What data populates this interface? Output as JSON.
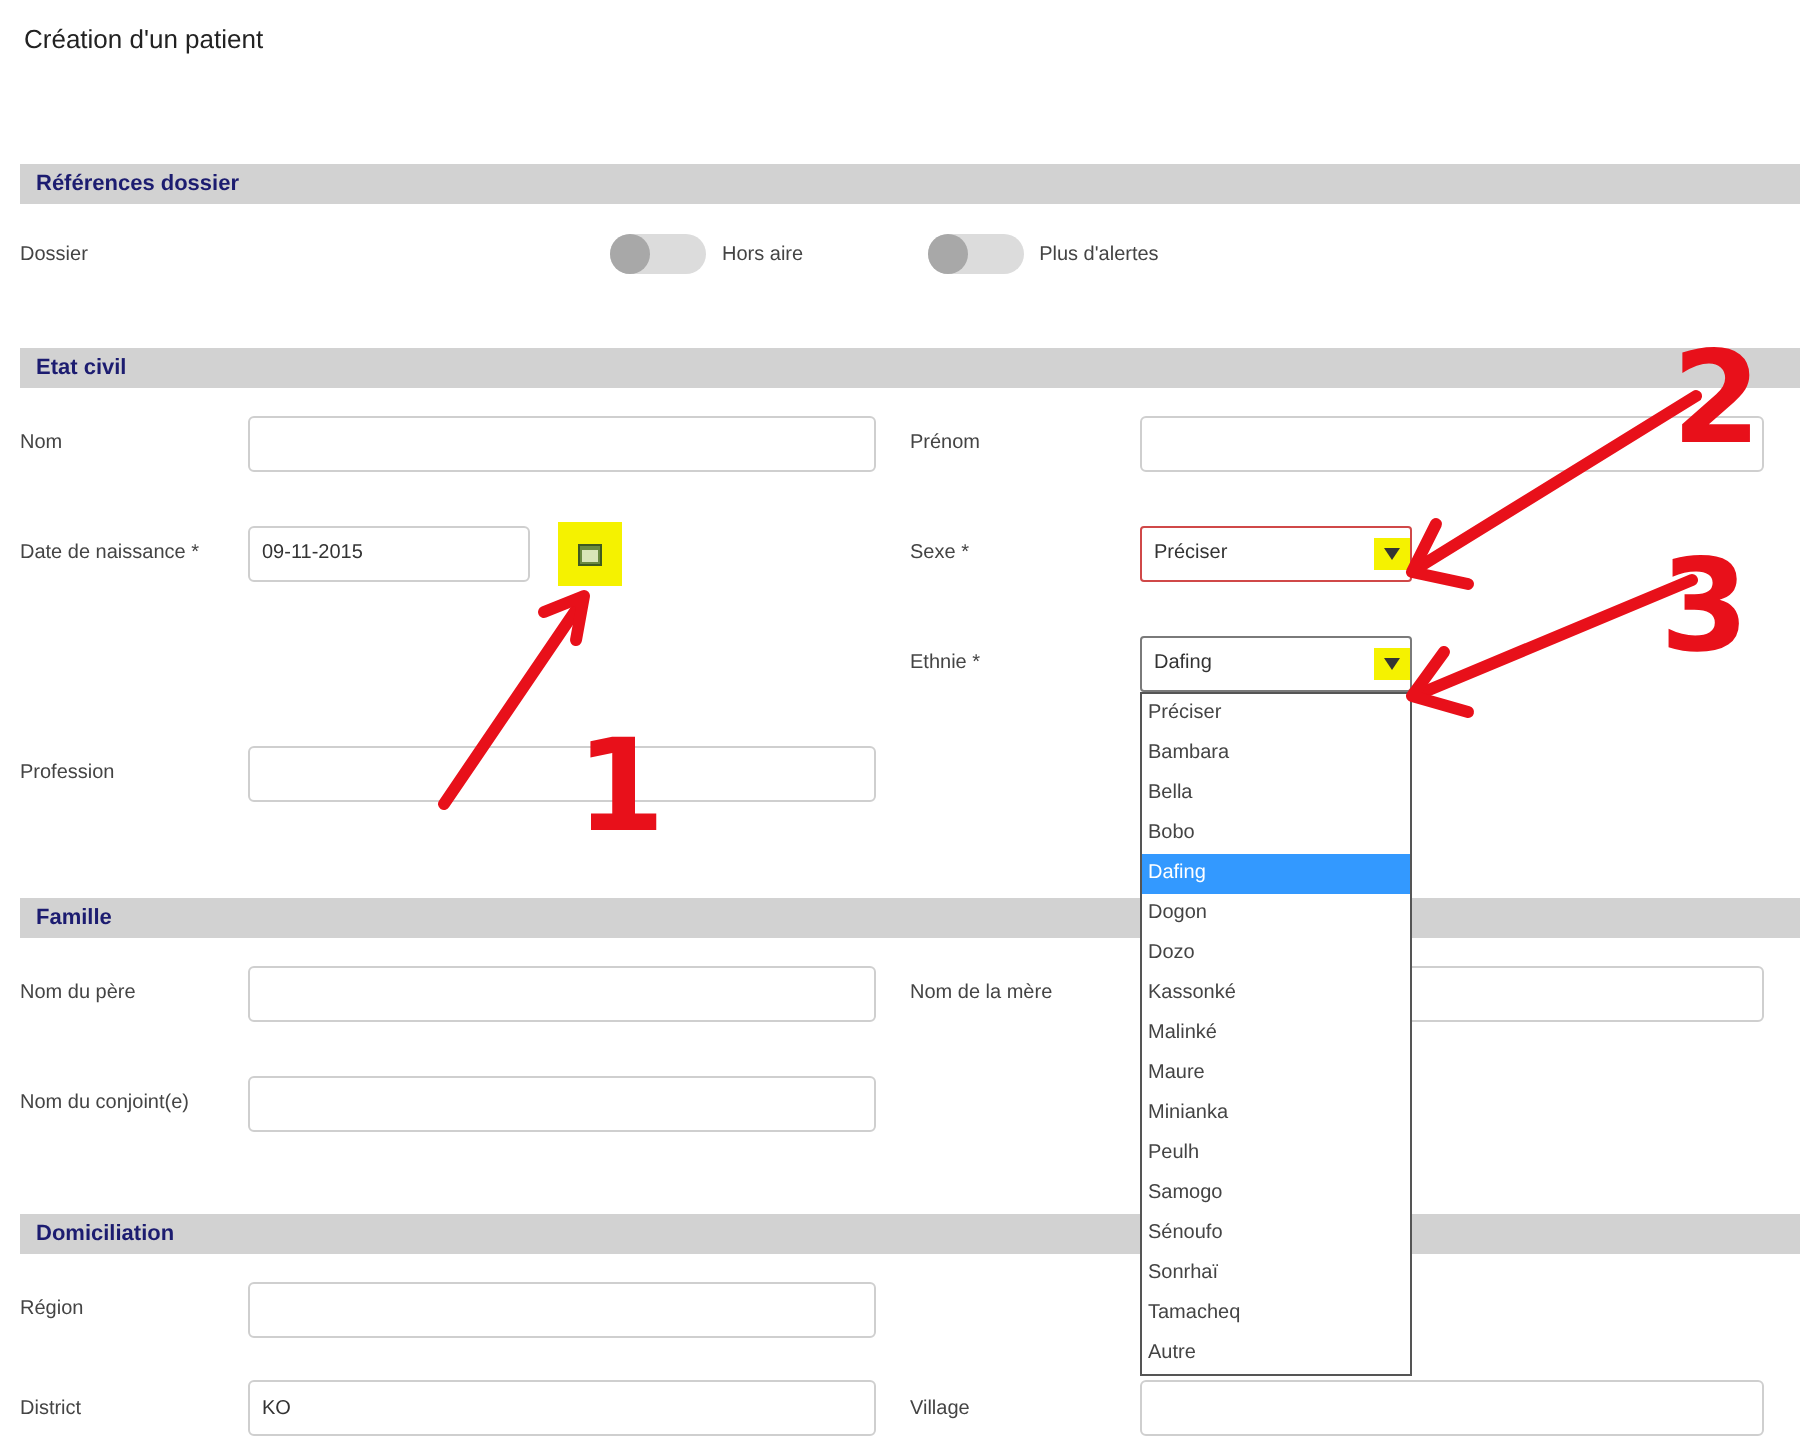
{
  "title": "Création d'un patient",
  "sections": [
    {
      "title": "Références dossier",
      "rows": [
        {
          "kind": "toggles",
          "label": "Dossier",
          "toggles": [
            {
              "label": "Hors aire",
              "on": false
            },
            {
              "label": "Plus d'alertes",
              "on": false
            }
          ]
        }
      ]
    },
    {
      "title": "Etat civil",
      "rows": [
        {
          "kind": "fields",
          "left": {
            "label": "Nom",
            "kind": "text"
          },
          "right": {
            "label": "Prénom",
            "kind": "text"
          }
        },
        {
          "kind": "fields",
          "left": {
            "label": "Date de naissance *",
            "kind": "date",
            "value": "09-11-2015",
            "highlighted": true
          },
          "right": {
            "label": "Sexe *",
            "kind": "select",
            "value": "Préciser",
            "error": true,
            "highlighted": true
          }
        },
        {
          "kind": "fields",
          "right": {
            "label": "Ethnie *",
            "kind": "select",
            "value": "Dafing",
            "error": false,
            "highlighted": true,
            "options": [
              {
                "label": "Préciser",
                "selected": false
              },
              {
                "label": "Bambara",
                "selected": false
              },
              {
                "label": "Bella",
                "selected": false
              },
              {
                "label": "Bobo",
                "selected": false
              },
              {
                "label": "Dafing",
                "selected": true
              },
              {
                "label": "Dogon",
                "selected": false
              },
              {
                "label": "Dozo",
                "selected": false
              },
              {
                "label": "Kassonké",
                "selected": false
              },
              {
                "label": "Malinké",
                "selected": false
              },
              {
                "label": "Maure",
                "selected": false
              },
              {
                "label": "Minianka",
                "selected": false
              },
              {
                "label": "Peulh",
                "selected": false
              },
              {
                "label": "Samogo",
                "selected": false
              },
              {
                "label": "Sénoufo",
                "selected": false
              },
              {
                "label": "Sonrhaï",
                "selected": false
              },
              {
                "label": "Tamacheq",
                "selected": false
              },
              {
                "label": "Autre",
                "selected": false
              }
            ]
          }
        },
        {
          "kind": "fields",
          "left": {
            "label": "Profession",
            "kind": "text"
          }
        }
      ]
    },
    {
      "title": "Famille",
      "rows": [
        {
          "kind": "fields",
          "left": {
            "label": "Nom du père",
            "kind": "text"
          },
          "right": {
            "label": "Nom de la mère",
            "kind": "text"
          }
        },
        {
          "kind": "fields",
          "left": {
            "label": "Nom du conjoint(e)",
            "kind": "text"
          }
        }
      ]
    },
    {
      "title": "Domiciliation",
      "rows": [
        {
          "kind": "fields",
          "left": {
            "label": "Région",
            "kind": "text"
          }
        },
        {
          "kind": "fields",
          "left": {
            "label": "District",
            "kind": "text",
            "value": "KO"
          },
          "right": {
            "label": "Village",
            "kind": "text"
          }
        }
      ]
    }
  ],
  "annotations": [
    {
      "number": "1"
    },
    {
      "number": "2"
    },
    {
      "number": "3"
    }
  ]
}
